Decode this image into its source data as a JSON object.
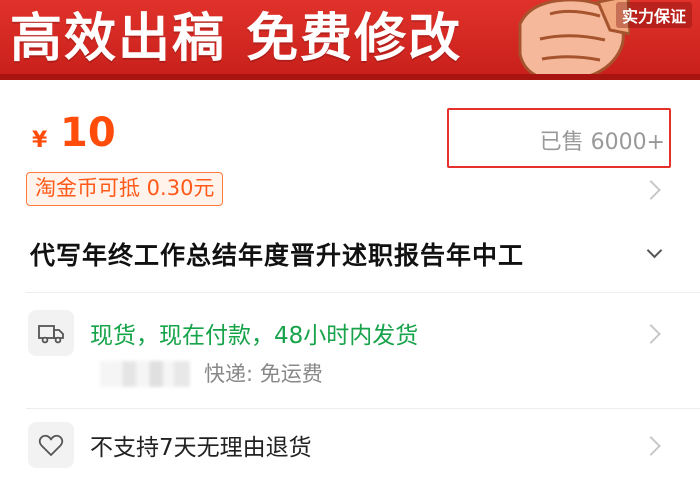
{
  "banner": {
    "slogan": "高效出稿  免费修改",
    "guarantee": "实力保证",
    "art": "thumbs-up-fist-icon",
    "colors": {
      "background": "#d8281f",
      "stripe": "#a8140f"
    }
  },
  "price": {
    "currency": "¥",
    "amount": "10",
    "sold": "已售 6000+",
    "color": "#ff4c0a"
  },
  "coupon": {
    "label": "淘金币可抵 0.30元"
  },
  "product": {
    "title": "代写年终工作总结年度晋升述职报告年中工"
  },
  "delivery": {
    "icon": "truck-icon",
    "status": "现货，现在付款，48小时内发货",
    "shipping": "快递: 免运费",
    "status_color": "#17a34a"
  },
  "returns": {
    "icon": "heart-icon",
    "label": "不支持7天无理由退货"
  }
}
